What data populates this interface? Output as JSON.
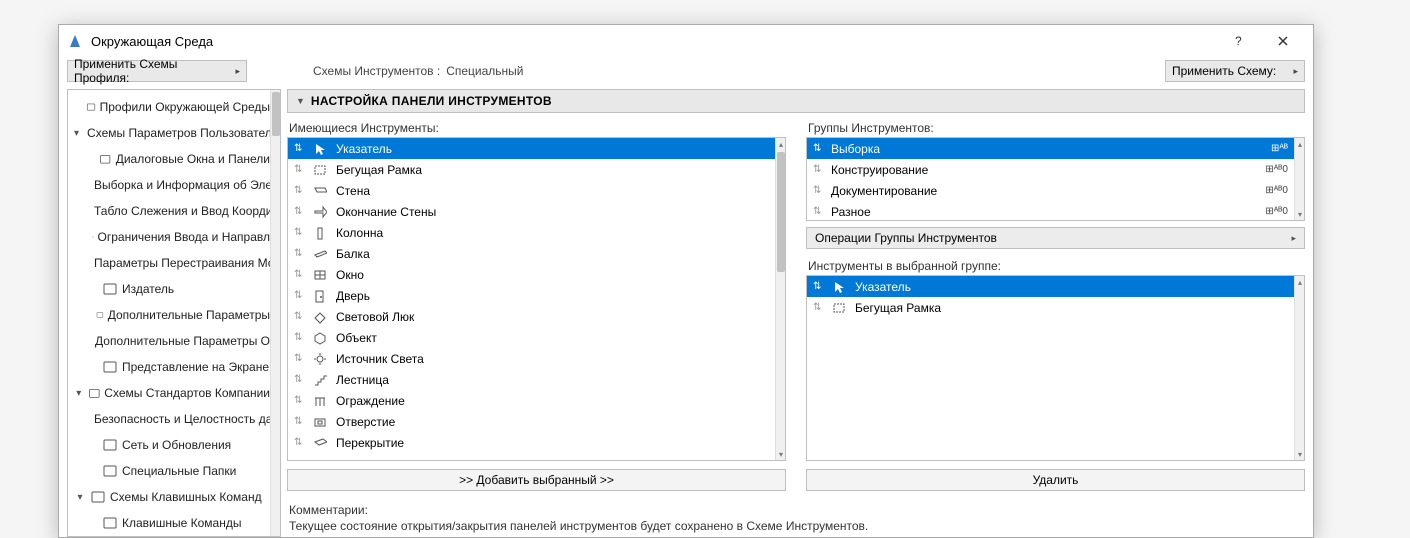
{
  "window": {
    "title": "Окружающая Среда"
  },
  "topbar": {
    "apply_profile": "Применить Схемы Профиля:",
    "crumb_left": "Схемы Инструментов :",
    "crumb_right": "Специальный",
    "apply_scheme": "Применить Схему:"
  },
  "sidebar": [
    {
      "level": 1,
      "expander": "",
      "label": "Профили Окружающей Среды"
    },
    {
      "level": 1,
      "expander": "▾",
      "label": "Схемы Параметров Пользователя"
    },
    {
      "level": 2,
      "expander": "",
      "label": "Диалоговые Окна и Панели"
    },
    {
      "level": 2,
      "expander": "",
      "label": "Выборка и Информация об Эле"
    },
    {
      "level": 2,
      "expander": "",
      "label": "Табло Слежения и Ввод Коорди"
    },
    {
      "level": 2,
      "expander": "",
      "label": "Ограничения Ввода и Направл"
    },
    {
      "level": 2,
      "expander": "",
      "label": "Параметры Перестраивания Мо"
    },
    {
      "level": 2,
      "expander": "",
      "label": "Издатель"
    },
    {
      "level": 2,
      "expander": "",
      "label": "Дополнительные Параметры"
    },
    {
      "level": 2,
      "expander": "",
      "label": "Дополнительные Параметры О"
    },
    {
      "level": 2,
      "expander": "",
      "label": "Представление на Экране"
    },
    {
      "level": 1,
      "expander": "▾",
      "label": "Схемы Стандартов Компании"
    },
    {
      "level": 2,
      "expander": "",
      "label": "Безопасность и Целостность да"
    },
    {
      "level": 2,
      "expander": "",
      "label": "Сеть и Обновления"
    },
    {
      "level": 2,
      "expander": "",
      "label": "Специальные Папки"
    },
    {
      "level": 1,
      "expander": "▾",
      "label": "Схемы Клавишных Команд"
    },
    {
      "level": 2,
      "expander": "",
      "label": "Клавишные Команды"
    }
  ],
  "panel": {
    "header": "НАСТРОЙКА ПАНЕЛИ ИНСТРУМЕНТОВ",
    "left_label": "Имеющиеся Инструменты:",
    "right_groups_label": "Группы Инструментов:",
    "ops_label": "Операции Группы Инструментов",
    "right_tools_label": "Инструменты в выбранной группе:",
    "btn_add": ">> Добавить выбранный >>",
    "btn_remove": "Удалить",
    "comments_label": "Комментарии:",
    "comments_text": "Текущее состояние открытия/закрытия панелей инструментов будет сохранено в Схеме Инструментов."
  },
  "tools": [
    {
      "name": "Указатель",
      "selected": true
    },
    {
      "name": "Бегущая Рамка"
    },
    {
      "name": "Стена"
    },
    {
      "name": "Окончание Стены"
    },
    {
      "name": "Колонна"
    },
    {
      "name": "Балка"
    },
    {
      "name": "Окно"
    },
    {
      "name": "Дверь"
    },
    {
      "name": "Световой Люк"
    },
    {
      "name": "Объект"
    },
    {
      "name": "Источник Света"
    },
    {
      "name": "Лестница"
    },
    {
      "name": "Ограждение"
    },
    {
      "name": "Отверстие"
    },
    {
      "name": "Перекрытие"
    }
  ],
  "groups": [
    {
      "name": "Выборка",
      "badge": "⊞ᴬᴮ",
      "selected": true
    },
    {
      "name": "Конструирование",
      "badge": "⊞ᴬᴮ0"
    },
    {
      "name": "Документирование",
      "badge": "⊞ᴬᴮ0"
    },
    {
      "name": "Разное",
      "badge": "⊞ᴬᴮ0"
    }
  ],
  "group_tools": [
    {
      "name": "Указатель",
      "selected": true
    },
    {
      "name": "Бегущая Рамка"
    }
  ]
}
